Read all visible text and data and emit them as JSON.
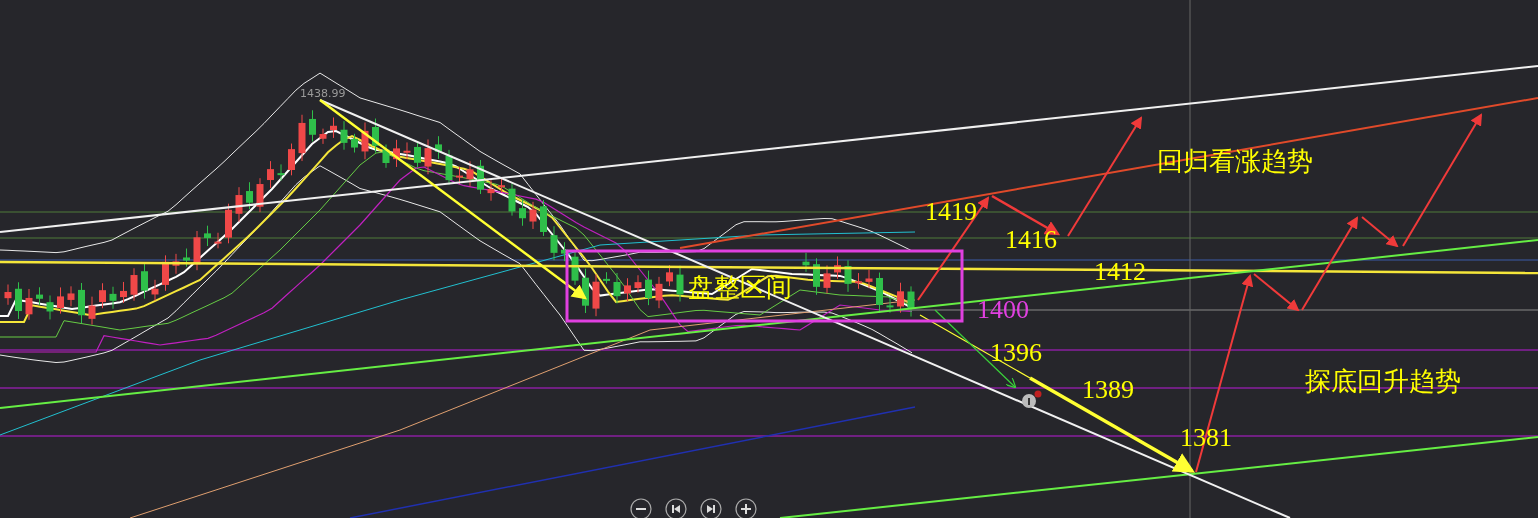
{
  "chart": {
    "peak_label": "1438.99",
    "zone_label": "盘整区间",
    "labels": [
      {
        "text": "1419",
        "color": "#ffff00"
      },
      {
        "text": "1416",
        "color": "#ffff00"
      },
      {
        "text": "回归看涨趋势",
        "color": "#ffff00"
      },
      {
        "text": "1412",
        "color": "#ffff00"
      },
      {
        "text": "1400",
        "color": "#e040e0"
      },
      {
        "text": "1396",
        "color": "#ffff00"
      },
      {
        "text": "1389",
        "color": "#ffff00"
      },
      {
        "text": "探底回升趋势",
        "color": "#ffff00"
      },
      {
        "text": "1381",
        "color": "#ffff00"
      }
    ]
  },
  "controls": [
    {
      "kind": "zoom-out"
    },
    {
      "kind": "previous"
    },
    {
      "kind": "next"
    },
    {
      "kind": "zoom-in"
    }
  ]
}
